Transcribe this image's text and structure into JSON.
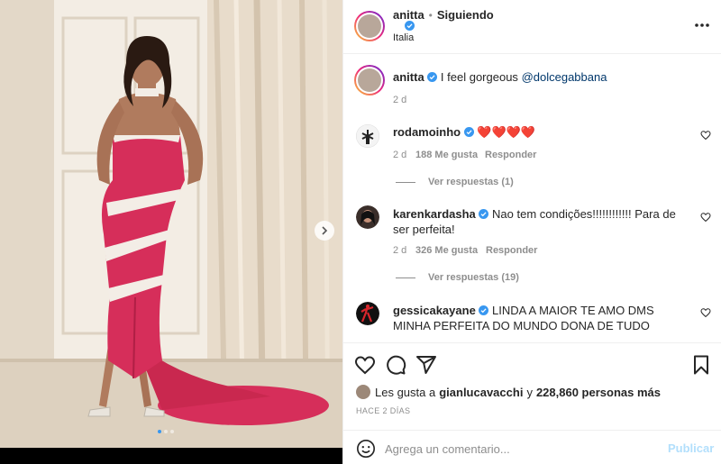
{
  "post": {
    "author": "anitta",
    "follow_state": "Siguiendo",
    "location": "Italia",
    "caption_text": "I feel gorgeous",
    "caption_mention": "@dolcegabbana",
    "caption_age": "2 d"
  },
  "comments": [
    {
      "user": "rodamoinho",
      "text": "❤️❤️❤️❤️",
      "age": "2 d",
      "likes": "188 Me gusta",
      "reply_label": "Responder",
      "view_replies": "Ver respuestas (1)"
    },
    {
      "user": "karenkardasha",
      "text": "Nao tem condições!!!!!!!!!!!! Para de ser perfeita!",
      "age": "2 d",
      "likes": "326 Me gusta",
      "reply_label": "Responder",
      "view_replies": "Ver respuestas (19)"
    },
    {
      "user": "gessicakayane",
      "text": "LINDA A MAIOR TE AMO DMS MINHA PERFEITA DO MUNDO DONA DE TUDO"
    }
  ],
  "likes_summary": {
    "prefix": "Les gusta a",
    "user": "gianlucavacchi",
    "joiner": "y",
    "count": "228,860 personas más"
  },
  "date_label": "HACE 2 DÍAS",
  "composer": {
    "placeholder": "Agrega un comentario...",
    "post_label": "Publicar"
  },
  "carousel": {
    "slide_count": 3,
    "active_slide": 1
  },
  "colors": {
    "verified": "#3897f0",
    "dress": "#d62e5a",
    "post_button_disabled": "#b2dffc"
  },
  "icons": [
    "more-options-icon",
    "verified-icon",
    "heart-icon",
    "comment-icon",
    "share-icon",
    "bookmark-icon",
    "emoji-icon",
    "chevron-right-icon"
  ]
}
